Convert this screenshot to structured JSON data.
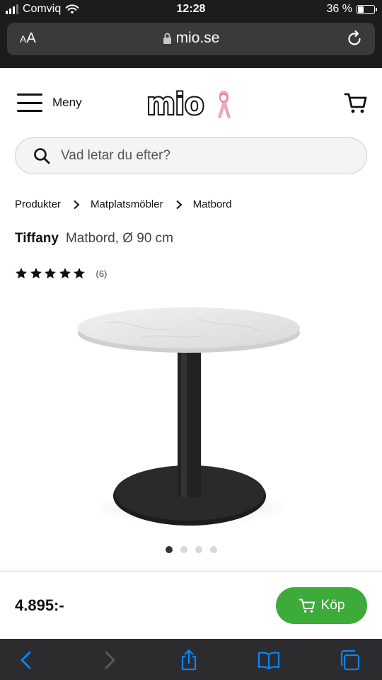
{
  "status_bar": {
    "carrier": "Comviq",
    "time": "12:28",
    "battery_percent": "36 %",
    "battery_level": 0.36
  },
  "browser": {
    "text_size_label_small": "A",
    "text_size_label_large": "A",
    "domain": "mio.se"
  },
  "header": {
    "menu_label": "Meny",
    "logo_text": "mio"
  },
  "search": {
    "placeholder": "Vad letar du efter?"
  },
  "breadcrumb": [
    "Produkter",
    "Matplatsmöbler",
    "Matbord"
  ],
  "product": {
    "brand": "Tiffany",
    "description": "Matbord, Ø 90 cm",
    "rating": 5,
    "rating_max": 5,
    "review_count": "(6)",
    "image_count": 4,
    "active_image": 1
  },
  "buy_bar": {
    "price": "4.895:-",
    "buy_label": "Köp"
  },
  "colors": {
    "buy_button": "#3cab3a",
    "ios_chrome": "#1c1c1e",
    "toolbar_icon": "#0a84ff"
  },
  "icons": [
    "wifi-icon",
    "lock-icon",
    "reload-icon",
    "hamburger-icon",
    "cart-icon",
    "search-icon",
    "chevron-right-icon",
    "star-icon",
    "back-icon",
    "forward-icon",
    "share-icon",
    "bookmarks-icon",
    "tabs-icon"
  ]
}
